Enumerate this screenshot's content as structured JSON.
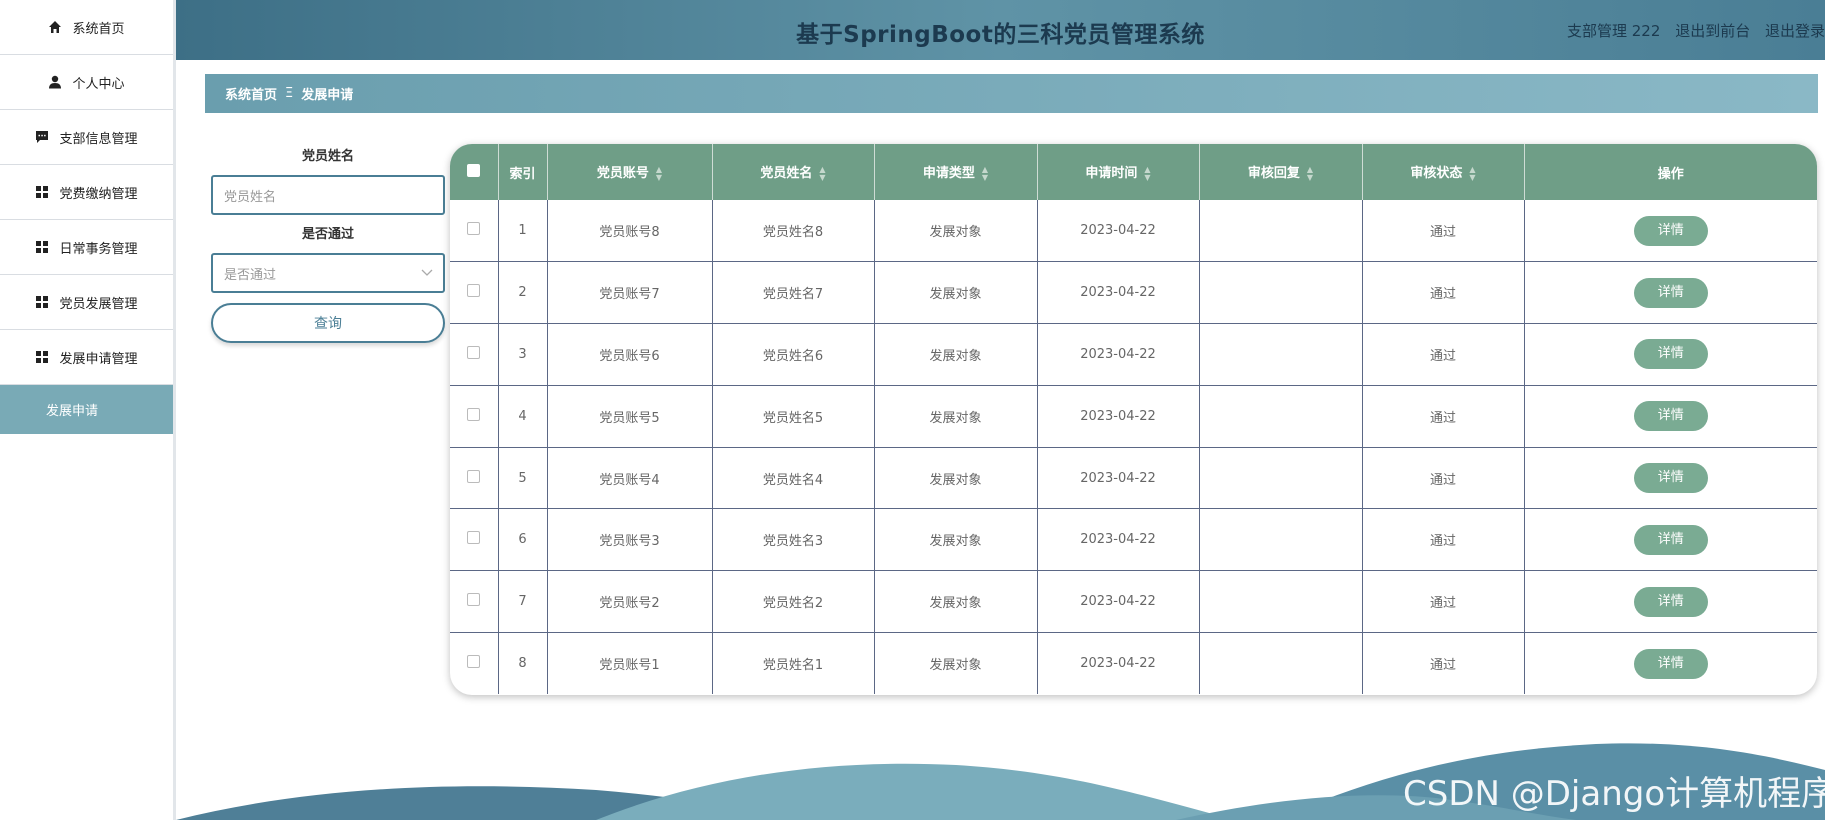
{
  "sidebar": {
    "items": [
      {
        "label": "系统首页",
        "icon": "home-icon"
      },
      {
        "label": "个人中心",
        "icon": "user-icon"
      },
      {
        "label": "支部信息管理",
        "icon": "message-icon"
      },
      {
        "label": "党费缴纳管理",
        "icon": "grid-icon"
      },
      {
        "label": "日常事务管理",
        "icon": "grid-icon"
      },
      {
        "label": "党员发展管理",
        "icon": "grid-icon"
      },
      {
        "label": "发展申请管理",
        "icon": "grid-icon"
      }
    ],
    "active_sub": "发展申请"
  },
  "header": {
    "title": "基于SpringBoot的三科党员管理系统",
    "user": "支部管理 222",
    "to_front": "退出到前台",
    "logout": "退出登录"
  },
  "breadcrumb": {
    "home": "系统首页",
    "separator": "Ξ",
    "current": "发展申请"
  },
  "search": {
    "name_label": "党员姓名",
    "name_placeholder": "党员姓名",
    "pass_label": "是否通过",
    "pass_placeholder": "是否通过",
    "query_button": "查询"
  },
  "table": {
    "headers": [
      "索引",
      "党员账号",
      "党员姓名",
      "申请类型",
      "申请时间",
      "审核回复",
      "审核状态",
      "操作"
    ],
    "rows": [
      {
        "index": "1",
        "account": "党员账号8",
        "name": "党员姓名8",
        "type": "发展对象",
        "time": "2023-04-22",
        "reply": "",
        "status": "通过",
        "action": "详情"
      },
      {
        "index": "2",
        "account": "党员账号7",
        "name": "党员姓名7",
        "type": "发展对象",
        "time": "2023-04-22",
        "reply": "",
        "status": "通过",
        "action": "详情"
      },
      {
        "index": "3",
        "account": "党员账号6",
        "name": "党员姓名6",
        "type": "发展对象",
        "time": "2023-04-22",
        "reply": "",
        "status": "通过",
        "action": "详情"
      },
      {
        "index": "4",
        "account": "党员账号5",
        "name": "党员姓名5",
        "type": "发展对象",
        "time": "2023-04-22",
        "reply": "",
        "status": "通过",
        "action": "详情"
      },
      {
        "index": "5",
        "account": "党员账号4",
        "name": "党员姓名4",
        "type": "发展对象",
        "time": "2023-04-22",
        "reply": "",
        "status": "通过",
        "action": "详情"
      },
      {
        "index": "6",
        "account": "党员账号3",
        "name": "党员姓名3",
        "type": "发展对象",
        "time": "2023-04-22",
        "reply": "",
        "status": "通过",
        "action": "详情"
      },
      {
        "index": "7",
        "account": "党员账号2",
        "name": "党员姓名2",
        "type": "发展对象",
        "time": "2023-04-22",
        "reply": "",
        "status": "通过",
        "action": "详情"
      },
      {
        "index": "8",
        "account": "党员账号1",
        "name": "党员姓名1",
        "type": "发展对象",
        "time": "2023-04-22",
        "reply": "",
        "status": "通过",
        "action": "详情"
      }
    ]
  },
  "watermark": "CSDN @Django计算机程序",
  "colors": {
    "header": "#4a7e95",
    "table_header": "#6f9e87",
    "detail_button": "#7aab93",
    "sidebar_active": "#79aab6"
  }
}
